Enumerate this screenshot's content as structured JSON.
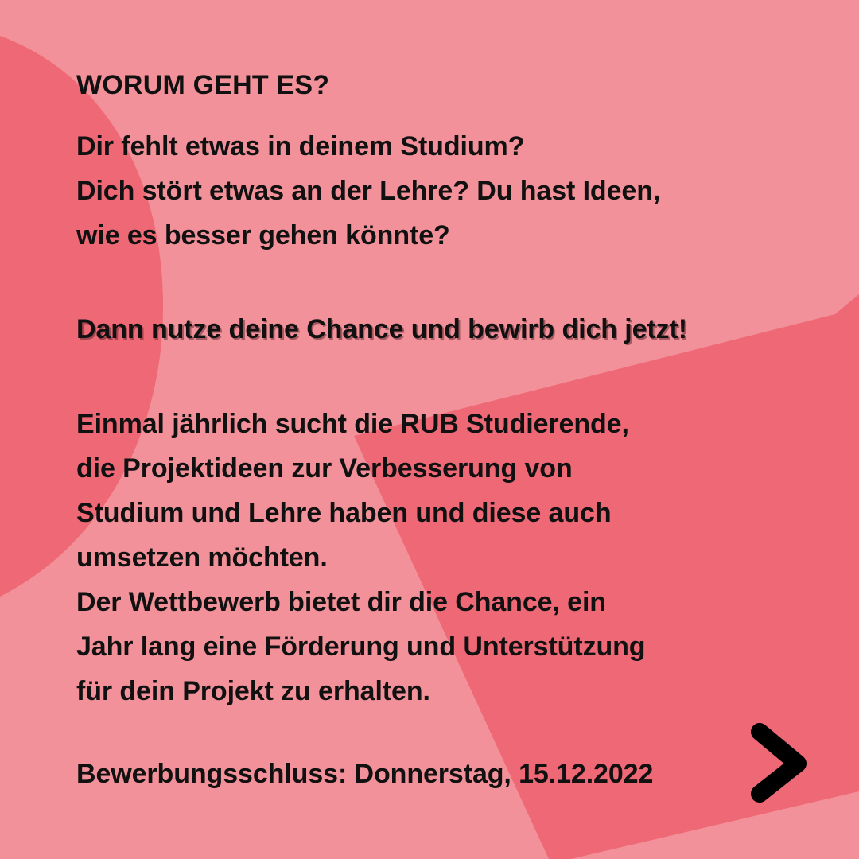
{
  "colors": {
    "background": "#f29199",
    "accent_shape": "#ee6876",
    "text": "#111111",
    "arrow": "#000000"
  },
  "slide": {
    "heading": "WORUM GEHT ES?",
    "intro_lines": [
      "Dir fehlt etwas in deinem Studium?",
      "Dich stört etwas an der Lehre? Du hast Ideen,",
      "wie es besser gehen könnte?"
    ],
    "cta": "Dann nutze deine Chance und bewirb dich jetzt!",
    "body_lines": [
      "Einmal jährlich sucht die RUB Studierende,",
      "die Projektideen zur Verbesserung von",
      "Studium und Lehre haben und diese auch",
      "umsetzen möchten.",
      "Der Wettbewerb bietet dir die Chance, ein",
      "Jahr lang eine Förderung und Unterstützung",
      "für dein Projekt zu erhalten."
    ],
    "deadline": "Bewerbungsschluss: Donnerstag, 15.12.2022"
  },
  "navigation": {
    "next_icon": "chevron-right-icon"
  }
}
